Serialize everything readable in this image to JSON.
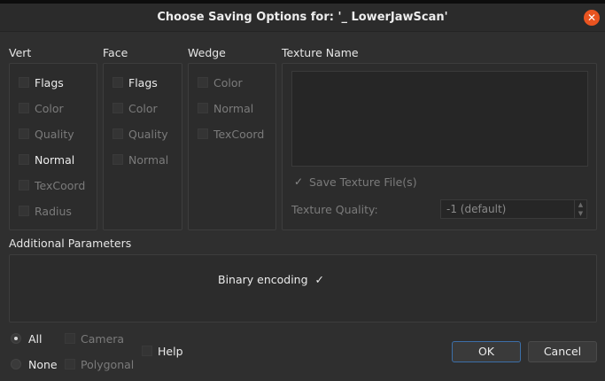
{
  "window": {
    "title": "Choose Saving Options for: '_ LowerJawScan'",
    "close_glyph": "✕"
  },
  "vert": {
    "label": "Vert",
    "items": [
      {
        "label": "Flags",
        "enabled": true
      },
      {
        "label": "Color",
        "enabled": false
      },
      {
        "label": "Quality",
        "enabled": false
      },
      {
        "label": "Normal",
        "enabled": true
      },
      {
        "label": "TexCoord",
        "enabled": false
      },
      {
        "label": "Radius",
        "enabled": false
      }
    ]
  },
  "face": {
    "label": "Face",
    "items": [
      {
        "label": "Flags",
        "enabled": true
      },
      {
        "label": "Color",
        "enabled": false
      },
      {
        "label": "Quality",
        "enabled": false
      },
      {
        "label": "Normal",
        "enabled": false
      }
    ]
  },
  "wedge": {
    "label": "Wedge",
    "items": [
      {
        "label": "Color",
        "enabled": false
      },
      {
        "label": "Normal",
        "enabled": false
      },
      {
        "label": "TexCoord",
        "enabled": false
      }
    ]
  },
  "texture": {
    "label": "Texture Name",
    "save_files_label": "Save Texture File(s)",
    "save_files_mark": "✓",
    "quality_label": "Texture Quality:",
    "quality_value": "-1 (default)",
    "spin_up": "▲",
    "spin_down": "▼"
  },
  "additional": {
    "label": "Additional Parameters",
    "binary_label": "Binary encoding",
    "binary_mark": "✓"
  },
  "bottom": {
    "all_label": "All",
    "none_label": "None",
    "selected": "All",
    "camera_label": "Camera",
    "polygonal_label": "Polygonal",
    "help_label": "Help",
    "ok_label": "OK",
    "cancel_label": "Cancel"
  },
  "colors": {
    "accent": "#e95420",
    "default_button_border": "#3c6fa8"
  }
}
